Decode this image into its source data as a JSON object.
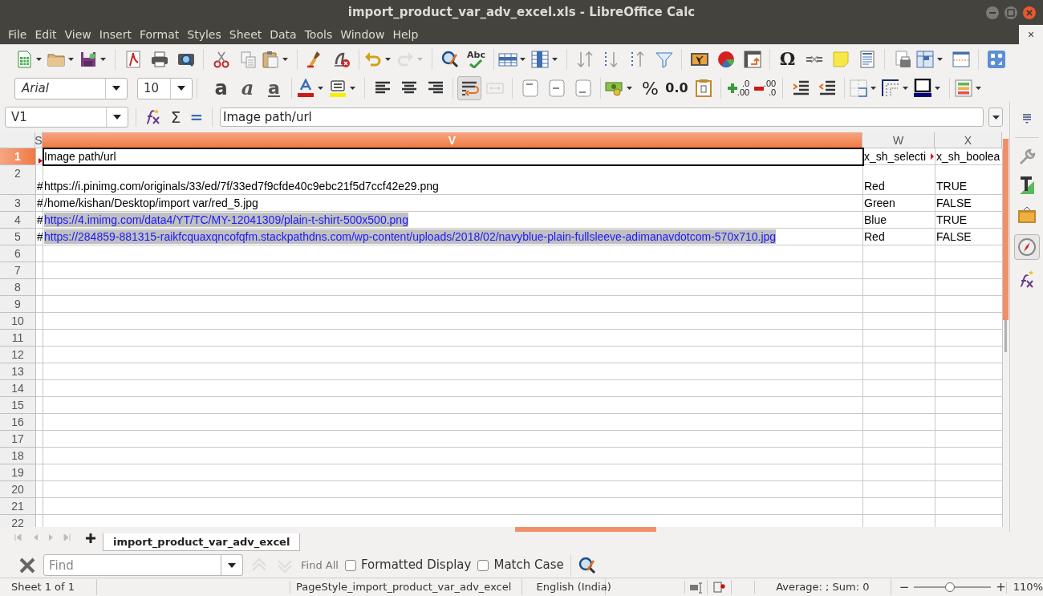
{
  "window": {
    "title": "import_product_var_adv_excel.xls - LibreOffice Calc",
    "close_document": "×"
  },
  "menu": [
    "File",
    "Edit",
    "View",
    "Insert",
    "Format",
    "Styles",
    "Sheet",
    "Data",
    "Tools",
    "Window",
    "Help"
  ],
  "formatting": {
    "font_name": "Arial",
    "font_size": "10",
    "bold": "a",
    "italic": "a",
    "underline": "a",
    "percent": "%",
    "decimal": "0.0",
    "add_decimal": [
      ".0",
      ".00"
    ],
    "delete_decimal": [
      ".00",
      ".0"
    ]
  },
  "standard": {
    "spelling": "Abc",
    "special_character": "Ω"
  },
  "formula_bar": {
    "name_box": "V1",
    "sum": "Σ",
    "equals": "=",
    "formula": "Image path/url"
  },
  "columns": [
    {
      "label": "S",
      "selected": false
    },
    {
      "label": "V",
      "selected": true
    },
    {
      "label": "W",
      "selected": false
    },
    {
      "label": "X",
      "selected": false
    }
  ],
  "rows": [
    {
      "label": "1",
      "selected": true,
      "tall": false,
      "cells": [
        {
          "kind": "clip_marker"
        },
        {
          "kind": "text",
          "text": "Image path/url"
        },
        {
          "kind": "clipped_text",
          "text": "x_sh_selecti"
        },
        {
          "kind": "text",
          "text": "x_sh_boolea"
        }
      ]
    },
    {
      "label": "2",
      "selected": false,
      "tall": true,
      "cells": [
        {
          "kind": "text",
          "text": "#"
        },
        {
          "kind": "text",
          "text": "https://i.pinimg.com/originals/33/ed/7f/33ed7f9cfde40c9ebc21f5d7ccf42e29.png"
        },
        {
          "kind": "text",
          "text": "Red"
        },
        {
          "kind": "text",
          "text": "TRUE"
        }
      ]
    },
    {
      "label": "3",
      "selected": false,
      "tall": false,
      "cells": [
        {
          "kind": "text",
          "text": "#"
        },
        {
          "kind": "text",
          "text": "/home/kishan/Desktop/import var/red_5.jpg"
        },
        {
          "kind": "text",
          "text": "Green"
        },
        {
          "kind": "text",
          "text": "FALSE"
        }
      ]
    },
    {
      "label": "4",
      "selected": false,
      "tall": false,
      "cells": [
        {
          "kind": "text",
          "text": "#"
        },
        {
          "kind": "link",
          "text": "https://4.imimg.com/data4/YT/TC/MY-12041309/plain-t-shirt-500x500.png"
        },
        {
          "kind": "text",
          "text": "Blue"
        },
        {
          "kind": "text",
          "text": "TRUE"
        }
      ]
    },
    {
      "label": "5",
      "selected": false,
      "tall": false,
      "cells": [
        {
          "kind": "text",
          "text": "#"
        },
        {
          "kind": "link",
          "text": "https://284859-881315-raikfcquaxqncofqfm.stackpathdns.com/wp-content/uploads/2018/02/navyblue-plain-fullsleeve-adimanavdotcom-570x710.jpg"
        },
        {
          "kind": "text",
          "text": "Red"
        },
        {
          "kind": "text",
          "text": "FALSE"
        }
      ]
    },
    {
      "label": "6",
      "selected": false,
      "tall": false
    },
    {
      "label": "7",
      "selected": false,
      "tall": false
    },
    {
      "label": "8",
      "selected": false,
      "tall": false
    },
    {
      "label": "9",
      "selected": false,
      "tall": false
    },
    {
      "label": "10",
      "selected": false,
      "tall": false
    },
    {
      "label": "11",
      "selected": false,
      "tall": false
    },
    {
      "label": "12",
      "selected": false,
      "tall": false
    },
    {
      "label": "13",
      "selected": false,
      "tall": false
    },
    {
      "label": "14",
      "selected": false,
      "tall": false
    },
    {
      "label": "15",
      "selected": false,
      "tall": false
    },
    {
      "label": "16",
      "selected": false,
      "tall": false
    },
    {
      "label": "17",
      "selected": false,
      "tall": false
    },
    {
      "label": "18",
      "selected": false,
      "tall": false
    },
    {
      "label": "19",
      "selected": false,
      "tall": false
    },
    {
      "label": "20",
      "selected": false,
      "tall": false
    },
    {
      "label": "21",
      "selected": false,
      "tall": false
    },
    {
      "label": "22",
      "selected": false,
      "tall": false
    }
  ],
  "sheet_tabs": [
    {
      "label": "import_product_var_adv_excel",
      "selected": true
    }
  ],
  "find_bar": {
    "placeholder": "Find",
    "find_all": "Find All",
    "options": [
      {
        "label": "Formatted Display",
        "checked": false
      },
      {
        "label": "Match Case",
        "checked": false
      }
    ]
  },
  "status_bar": {
    "sheet": "Sheet 1 of 1",
    "page_style": "PageStyle_import_product_var_adv_excel",
    "language": "English (India)",
    "summary": "Average: ; Sum: 0",
    "zoom_out": "−",
    "zoom_in": "+",
    "zoom": {
      "level": 0.47
    },
    "zoom_percent": "110%"
  }
}
